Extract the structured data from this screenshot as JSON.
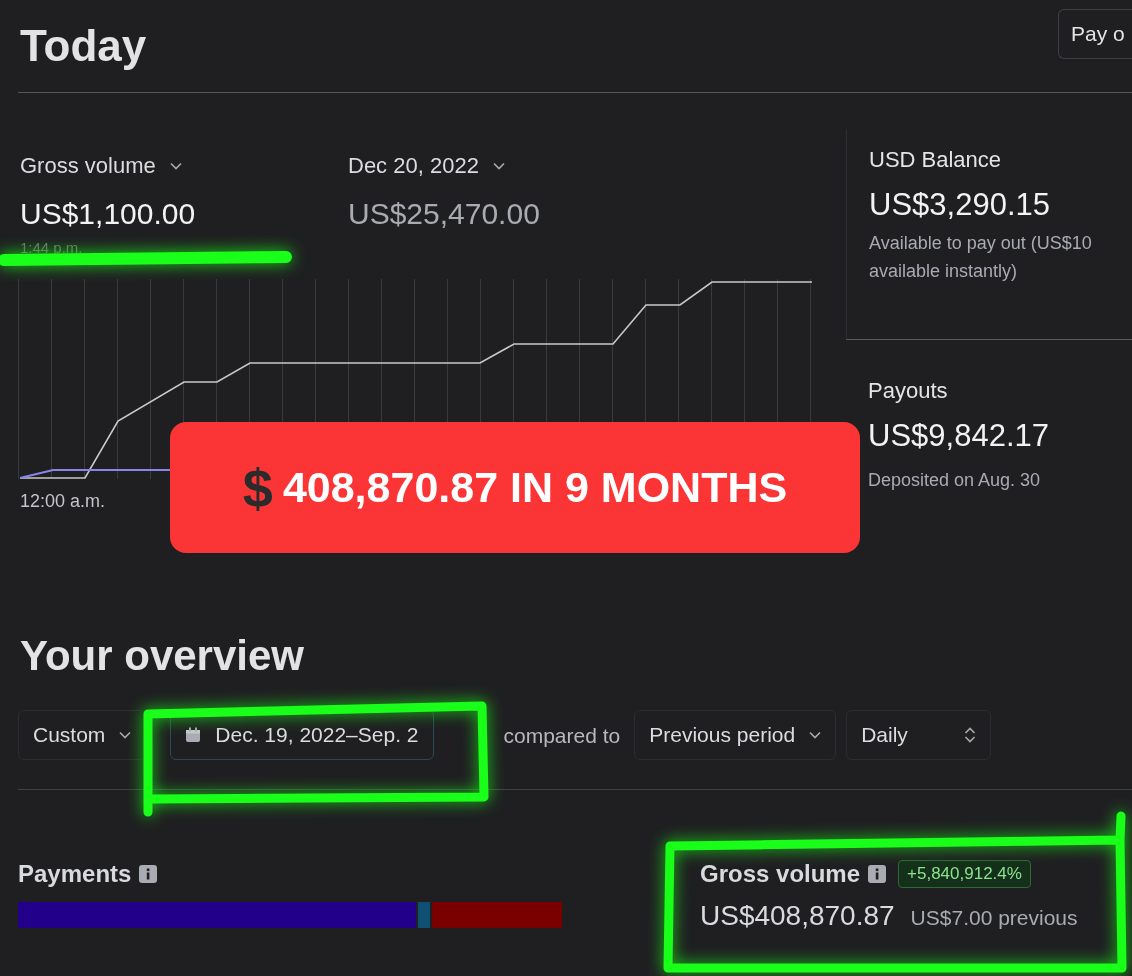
{
  "header": {
    "title": "Today",
    "button": "Pay o"
  },
  "today": {
    "metrics": [
      {
        "label": "Gross volume",
        "value": "US$1,100.00",
        "muted": false
      },
      {
        "label": "Dec 20, 2022",
        "value": "US$25,470.00",
        "muted": true
      }
    ],
    "time": "1:44 p.m.",
    "chart_start": "12:00 a.m.",
    "balance": {
      "title": "USD Balance",
      "value": "US$3,290.15",
      "note": "Available to pay out (US$10",
      "note_2": "available instantly)"
    },
    "payouts": {
      "title": "Payouts",
      "value": "US$9,842.17",
      "note": "Deposited on Aug. 30"
    }
  },
  "banner": {
    "symbol": "$",
    "text": "408,870.87 IN 9 MONTHS"
  },
  "overview": {
    "title": "Your overview",
    "filters": [
      {
        "kind": "dropdown",
        "label": "Custom"
      },
      {
        "kind": "date",
        "label": "Dec. 19, 2022–Sep. 2"
      },
      {
        "kind": "text",
        "label": "compared to"
      },
      {
        "kind": "dropdown",
        "label": "Previous period"
      },
      {
        "kind": "stepper",
        "label": "Daily"
      }
    ],
    "payments": {
      "title": "Payments"
    },
    "gross": {
      "title": "Gross volume",
      "change": "+5,840,912.4%",
      "value": "US$408,870.87",
      "previous": "US$7.00 previous"
    }
  },
  "annotations": [
    {
      "kind": "underline"
    },
    {
      "kind": "box"
    },
    {
      "kind": "box"
    }
  ]
}
